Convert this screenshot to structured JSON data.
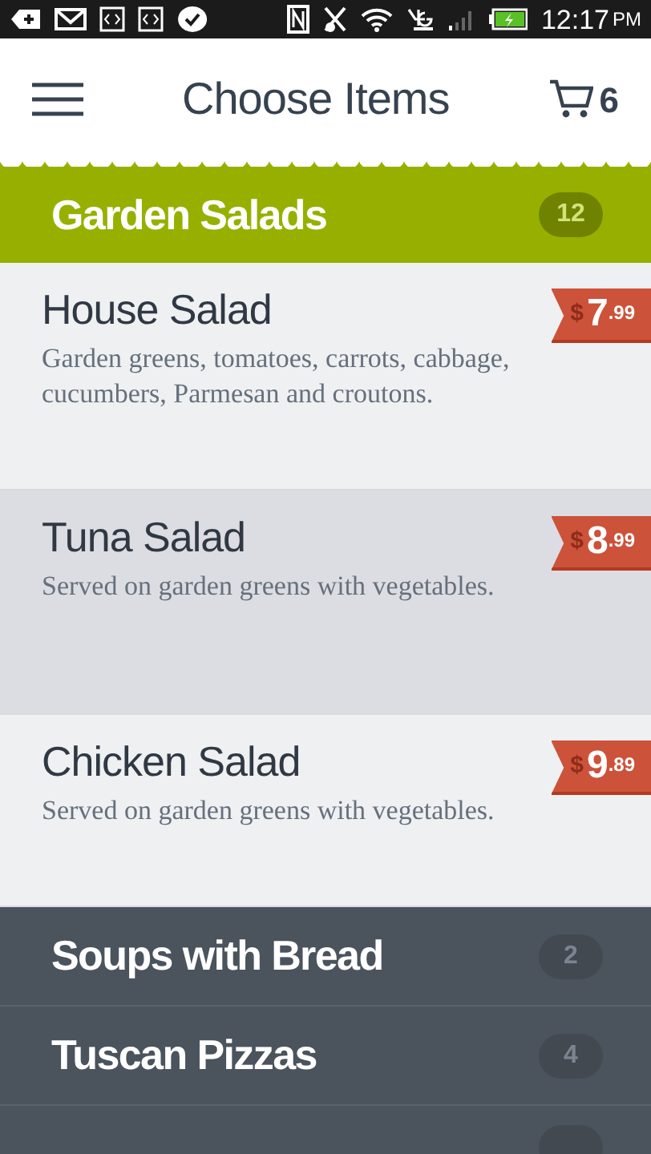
{
  "status_bar": {
    "time": "12:17",
    "meridiem": "PM"
  },
  "header": {
    "title": "Choose Items",
    "cart_count": "6"
  },
  "categories": [
    {
      "kind": "open",
      "name": "Garden Salads",
      "count": "12",
      "items": [
        {
          "name": "House Salad",
          "description": "Garden greens, tomatoes, carrots, cabbage, cucumbers, Parmesan and croutons.",
          "currency": "$",
          "whole": "7",
          "cents": ".99",
          "selected": false
        },
        {
          "name": "Tuna Salad",
          "description": "Served on garden greens with vegetables.",
          "currency": "$",
          "whole": "8",
          "cents": ".99",
          "selected": true
        },
        {
          "name": "Chicken Salad",
          "description": "Served on garden greens with vegetables.",
          "currency": "$",
          "whole": "9",
          "cents": ".89",
          "selected": false
        }
      ]
    },
    {
      "kind": "closed",
      "name": "Soups with Bread",
      "count": "2"
    },
    {
      "kind": "closed",
      "name": "Tuscan Pizzas",
      "count": "4"
    },
    {
      "kind": "cut_off"
    }
  ]
}
